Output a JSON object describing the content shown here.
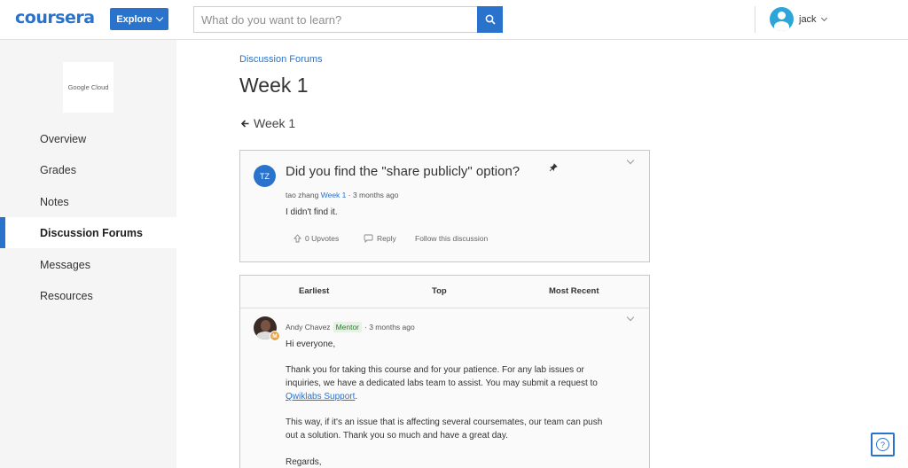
{
  "header": {
    "logo": "coursera",
    "explore_label": "Explore",
    "search_placeholder": "What do you want to learn?",
    "username": "jack"
  },
  "sidebar": {
    "course_logo_text": "Google Cloud",
    "items": [
      {
        "label": "Overview"
      },
      {
        "label": "Grades"
      },
      {
        "label": "Notes"
      },
      {
        "label": "Discussion Forums",
        "active": true
      },
      {
        "label": "Messages"
      },
      {
        "label": "Resources"
      }
    ]
  },
  "main": {
    "breadcrumb": "Discussion Forums",
    "title": "Week 1",
    "back_link": "Week 1"
  },
  "thread": {
    "author_initials": "TZ",
    "title": "Did you find the \"share publicly\" option?",
    "author": "tao zhang",
    "forum": "Week 1",
    "time": "· 3 months ago",
    "body": "I didn't find it.",
    "upvotes": "0 Upvotes",
    "reply_label": "Reply",
    "follow_label": "Follow this discussion"
  },
  "sort_tabs": [
    "Earliest",
    "Top",
    "Most Recent"
  ],
  "reply": {
    "author": "Andy Chavez",
    "role": "Mentor",
    "time": "· 3 months ago",
    "badge": "M",
    "greeting": "Hi everyone,",
    "para1_line1": "Thank you for taking this course and for your patience. For any lab issues or",
    "para1_line2": "inquiries, we have a dedicated labs team to assist. You may submit a request to",
    "link": "Qwiklabs Support",
    "link_suffix": ".",
    "para2_line1": "This way, if it's an issue that is affecting several coursemates, our team can push",
    "para2_line2": "out a solution. Thank you so much and have a great day.",
    "regards": "Regards,"
  },
  "help": {
    "label": "?"
  },
  "colors": {
    "accent": "#2a73cc",
    "mentor": "#2d7a2d"
  }
}
